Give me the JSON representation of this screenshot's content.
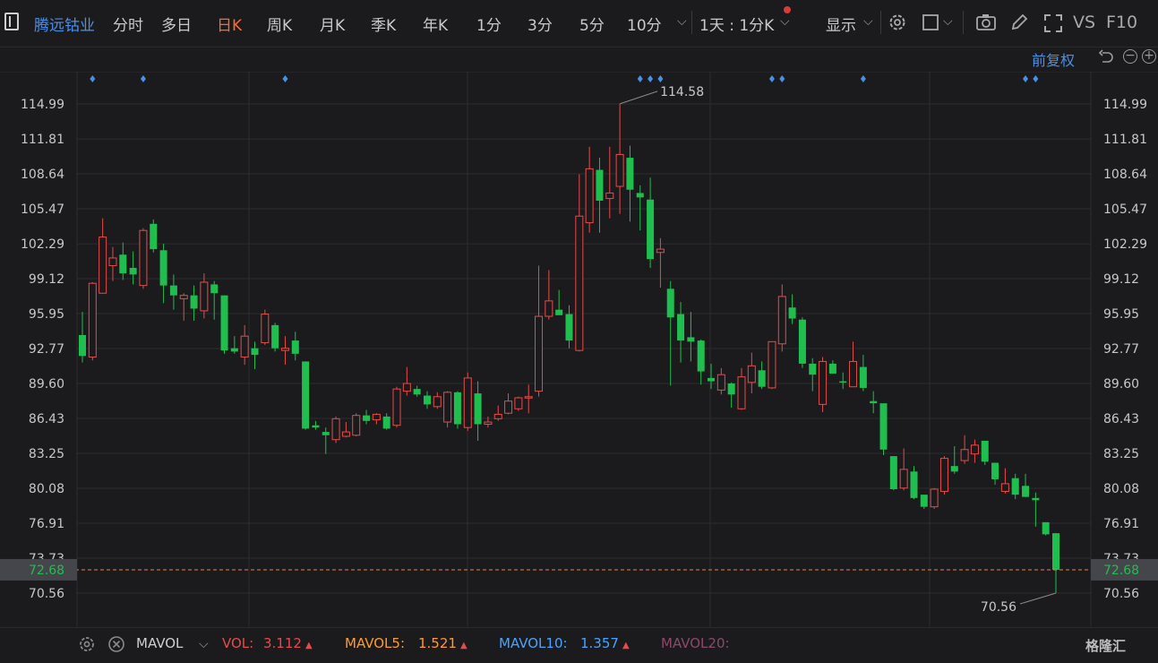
{
  "toolbar": {
    "stock_name": "腾远钴业",
    "tabs": [
      "分时",
      "多日",
      "日K",
      "周K",
      "月K",
      "季K",
      "年K",
      "1分",
      "3分",
      "5分",
      "10分"
    ],
    "active_tab": "日K",
    "period_select": "1天 : 1分K",
    "display_label": "显示",
    "vs_label": "VS",
    "f10_label": "F10"
  },
  "adjust": {
    "label": "前复权"
  },
  "volume_bar": {
    "indicator": "MAVOL",
    "vol_label": "VOL:",
    "vol_value": "3.112",
    "mavol5_label": "MAVOL5:",
    "mavol5_value": "1.521",
    "mavol10_label": "MAVOL10:",
    "mavol10_value": "1.357",
    "mavol20_label": "MAVOL20:",
    "colors": {
      "vol": "#e84a4a",
      "mavol5": "#ff9a2e",
      "mavol10": "#4aa3ff",
      "mavol20": "#8a4a6a"
    }
  },
  "watermark": "格隆汇",
  "chart_data": {
    "type": "candlestick",
    "y_ticks": [
      "114.99",
      "111.81",
      "108.64",
      "105.47",
      "102.29",
      "99.12",
      "95.95",
      "92.77",
      "89.60",
      "86.43",
      "83.25",
      "80.08",
      "76.91",
      "73.73",
      "70.56"
    ],
    "ylim": [
      69.5,
      117.5
    ],
    "last_price": "72.68",
    "high_label": "114.58",
    "low_label": "70.56",
    "colors": {
      "up": "#e84a4a",
      "down": "#1fbf4f",
      "grid": "#2c2c2e",
      "last_line": "#e8804a",
      "marker": "#4a8fe8"
    },
    "candles": [
      {
        "o": 94.0,
        "h": 96.1,
        "l": 91.5,
        "c": 92.1
      },
      {
        "o": 92.0,
        "h": 98.8,
        "l": 91.7,
        "c": 98.7
      },
      {
        "o": 97.8,
        "h": 104.6,
        "l": 97.8,
        "c": 102.9
      },
      {
        "o": 100.3,
        "h": 102.0,
        "l": 98.9,
        "c": 101.0
      },
      {
        "o": 101.3,
        "h": 102.4,
        "l": 99.0,
        "c": 99.6
      },
      {
        "o": 100.1,
        "h": 101.6,
        "l": 98.6,
        "c": 99.5
      },
      {
        "o": 98.5,
        "h": 103.7,
        "l": 98.2,
        "c": 103.5
      },
      {
        "o": 104.1,
        "h": 104.5,
        "l": 101.5,
        "c": 101.8
      },
      {
        "o": 101.7,
        "h": 102.3,
        "l": 96.9,
        "c": 98.5
      },
      {
        "o": 98.5,
        "h": 99.5,
        "l": 96.3,
        "c": 97.6
      },
      {
        "o": 97.3,
        "h": 97.8,
        "l": 95.3,
        "c": 97.6
      },
      {
        "o": 97.6,
        "h": 98.5,
        "l": 95.3,
        "c": 96.4
      },
      {
        "o": 96.2,
        "h": 99.6,
        "l": 95.5,
        "c": 98.8
      },
      {
        "o": 98.6,
        "h": 98.9,
        "l": 95.4,
        "c": 97.8
      },
      {
        "o": 97.6,
        "h": 97.6,
        "l": 92.3,
        "c": 92.6
      },
      {
        "o": 92.8,
        "h": 93.9,
        "l": 92.3,
        "c": 92.5
      },
      {
        "o": 92.0,
        "h": 94.9,
        "l": 91.3,
        "c": 93.9
      },
      {
        "o": 92.8,
        "h": 93.4,
        "l": 90.9,
        "c": 92.2
      },
      {
        "o": 93.3,
        "h": 96.3,
        "l": 93.1,
        "c": 95.9
      },
      {
        "o": 94.9,
        "h": 95.1,
        "l": 92.5,
        "c": 92.8
      },
      {
        "o": 92.6,
        "h": 93.9,
        "l": 91.3,
        "c": 92.8
      },
      {
        "o": 93.5,
        "h": 94.3,
        "l": 91.7,
        "c": 92.3
      },
      {
        "o": 91.6,
        "h": 91.6,
        "l": 85.4,
        "c": 85.5
      },
      {
        "o": 85.8,
        "h": 86.2,
        "l": 85.4,
        "c": 85.6
      },
      {
        "o": 85.2,
        "h": 85.6,
        "l": 83.2,
        "c": 84.9
      },
      {
        "o": 84.5,
        "h": 86.6,
        "l": 84.2,
        "c": 86.4
      },
      {
        "o": 84.8,
        "h": 86.1,
        "l": 84.7,
        "c": 85.2
      },
      {
        "o": 84.9,
        "h": 86.9,
        "l": 84.8,
        "c": 86.7
      },
      {
        "o": 86.7,
        "h": 87.2,
        "l": 85.9,
        "c": 86.2
      },
      {
        "o": 86.3,
        "h": 86.9,
        "l": 85.9,
        "c": 86.8
      },
      {
        "o": 86.6,
        "h": 86.9,
        "l": 85.4,
        "c": 85.5
      },
      {
        "o": 85.8,
        "h": 89.3,
        "l": 85.6,
        "c": 89.1
      },
      {
        "o": 88.9,
        "h": 91.1,
        "l": 88.5,
        "c": 89.6
      },
      {
        "o": 89.1,
        "h": 89.4,
        "l": 88.4,
        "c": 88.6
      },
      {
        "o": 88.5,
        "h": 88.9,
        "l": 87.3,
        "c": 87.7
      },
      {
        "o": 87.5,
        "h": 88.8,
        "l": 87.3,
        "c": 88.4
      },
      {
        "o": 86.1,
        "h": 88.9,
        "l": 85.6,
        "c": 88.8
      },
      {
        "o": 88.8,
        "h": 88.9,
        "l": 85.5,
        "c": 85.9
      },
      {
        "o": 85.6,
        "h": 90.6,
        "l": 85.3,
        "c": 90.1
      },
      {
        "o": 88.7,
        "h": 89.8,
        "l": 84.4,
        "c": 85.9
      },
      {
        "o": 85.9,
        "h": 86.6,
        "l": 85.6,
        "c": 86.1
      },
      {
        "o": 86.4,
        "h": 87.6,
        "l": 86.2,
        "c": 86.8
      },
      {
        "o": 86.9,
        "h": 88.7,
        "l": 86.8,
        "c": 88.0
      },
      {
        "o": 87.3,
        "h": 88.4,
        "l": 87.1,
        "c": 88.3
      },
      {
        "o": 88.4,
        "h": 89.5,
        "l": 86.9,
        "c": 88.4
      },
      {
        "o": 88.9,
        "h": 100.3,
        "l": 88.4,
        "c": 95.7
      },
      {
        "o": 95.7,
        "h": 99.9,
        "l": 95.4,
        "c": 97.1
      },
      {
        "o": 96.3,
        "h": 98.1,
        "l": 96.1,
        "c": 95.8
      },
      {
        "o": 95.9,
        "h": 96.7,
        "l": 92.8,
        "c": 93.5
      },
      {
        "o": 92.6,
        "h": 108.6,
        "l": 92.5,
        "c": 104.8
      },
      {
        "o": 104.2,
        "h": 111.1,
        "l": 103.3,
        "c": 109.1
      },
      {
        "o": 109.0,
        "h": 110.1,
        "l": 103.3,
        "c": 106.2
      },
      {
        "o": 106.4,
        "h": 111.1,
        "l": 104.6,
        "c": 106.9
      },
      {
        "o": 107.5,
        "h": 115.0,
        "l": 105.0,
        "c": 110.4
      },
      {
        "o": 110.1,
        "h": 111.2,
        "l": 104.3,
        "c": 107.2
      },
      {
        "o": 106.9,
        "h": 107.6,
        "l": 103.5,
        "c": 106.5
      },
      {
        "o": 106.3,
        "h": 108.3,
        "l": 100.1,
        "c": 100.9
      },
      {
        "o": 101.5,
        "h": 102.8,
        "l": 98.3,
        "c": 101.8
      },
      {
        "o": 98.2,
        "h": 98.9,
        "l": 89.4,
        "c": 95.6
      },
      {
        "o": 95.9,
        "h": 97.0,
        "l": 91.5,
        "c": 93.5
      },
      {
        "o": 93.8,
        "h": 96.1,
        "l": 91.6,
        "c": 93.4
      },
      {
        "o": 93.5,
        "h": 93.6,
        "l": 89.5,
        "c": 90.7
      },
      {
        "o": 90.1,
        "h": 91.4,
        "l": 89.1,
        "c": 89.8
      },
      {
        "o": 89.0,
        "h": 91.0,
        "l": 88.6,
        "c": 90.4
      },
      {
        "o": 89.6,
        "h": 89.7,
        "l": 87.4,
        "c": 88.6
      },
      {
        "o": 87.3,
        "h": 91.0,
        "l": 87.2,
        "c": 90.2
      },
      {
        "o": 89.7,
        "h": 92.4,
        "l": 88.7,
        "c": 91.2
      },
      {
        "o": 90.8,
        "h": 91.6,
        "l": 89.1,
        "c": 89.3
      },
      {
        "o": 89.2,
        "h": 93.2,
        "l": 89.1,
        "c": 93.4
      },
      {
        "o": 93.2,
        "h": 98.6,
        "l": 92.5,
        "c": 97.5
      },
      {
        "o": 96.5,
        "h": 97.7,
        "l": 95.0,
        "c": 95.5
      },
      {
        "o": 95.4,
        "h": 95.6,
        "l": 91.0,
        "c": 91.4
      },
      {
        "o": 91.4,
        "h": 91.9,
        "l": 88.9,
        "c": 90.4
      },
      {
        "o": 87.7,
        "h": 92.0,
        "l": 87.0,
        "c": 91.6
      },
      {
        "o": 91.4,
        "h": 91.7,
        "l": 90.5,
        "c": 90.5
      },
      {
        "o": 89.8,
        "h": 90.6,
        "l": 89.1,
        "c": 89.7
      },
      {
        "o": 89.3,
        "h": 93.4,
        "l": 89.3,
        "c": 91.6
      },
      {
        "o": 91.1,
        "h": 92.2,
        "l": 88.9,
        "c": 89.2
      },
      {
        "o": 88.0,
        "h": 88.9,
        "l": 86.9,
        "c": 87.8
      },
      {
        "o": 87.8,
        "h": 87.8,
        "l": 83.1,
        "c": 83.6
      },
      {
        "o": 83.0,
        "h": 83.0,
        "l": 79.9,
        "c": 80.0
      },
      {
        "o": 80.1,
        "h": 83.7,
        "l": 79.9,
        "c": 81.8
      },
      {
        "o": 81.6,
        "h": 82.1,
        "l": 79.1,
        "c": 79.2
      },
      {
        "o": 79.5,
        "h": 79.5,
        "l": 78.2,
        "c": 78.4
      },
      {
        "o": 78.4,
        "h": 80.1,
        "l": 78.2,
        "c": 80.0
      },
      {
        "o": 79.8,
        "h": 83.0,
        "l": 79.5,
        "c": 82.8
      },
      {
        "o": 82.1,
        "h": 83.9,
        "l": 81.4,
        "c": 81.6
      },
      {
        "o": 82.6,
        "h": 84.9,
        "l": 82.3,
        "c": 83.6
      },
      {
        "o": 83.2,
        "h": 84.5,
        "l": 82.4,
        "c": 84.0
      },
      {
        "o": 84.4,
        "h": 84.4,
        "l": 82.2,
        "c": 82.5
      },
      {
        "o": 82.4,
        "h": 82.4,
        "l": 80.4,
        "c": 80.9
      },
      {
        "o": 79.8,
        "h": 81.9,
        "l": 79.6,
        "c": 80.5
      },
      {
        "o": 81.0,
        "h": 81.4,
        "l": 79.1,
        "c": 79.5
      },
      {
        "o": 80.3,
        "h": 81.4,
        "l": 79.3,
        "c": 79.3
      },
      {
        "o": 79.2,
        "h": 79.7,
        "l": 76.6,
        "c": 79.0
      },
      {
        "o": 77.0,
        "h": 77.0,
        "l": 75.8,
        "c": 75.9
      },
      {
        "o": 76.0,
        "h": 76.0,
        "l": 70.56,
        "c": 72.68
      }
    ],
    "event_marker_indices": [
      1,
      6,
      20,
      55,
      56,
      57,
      68,
      69,
      77,
      93,
      94
    ]
  }
}
